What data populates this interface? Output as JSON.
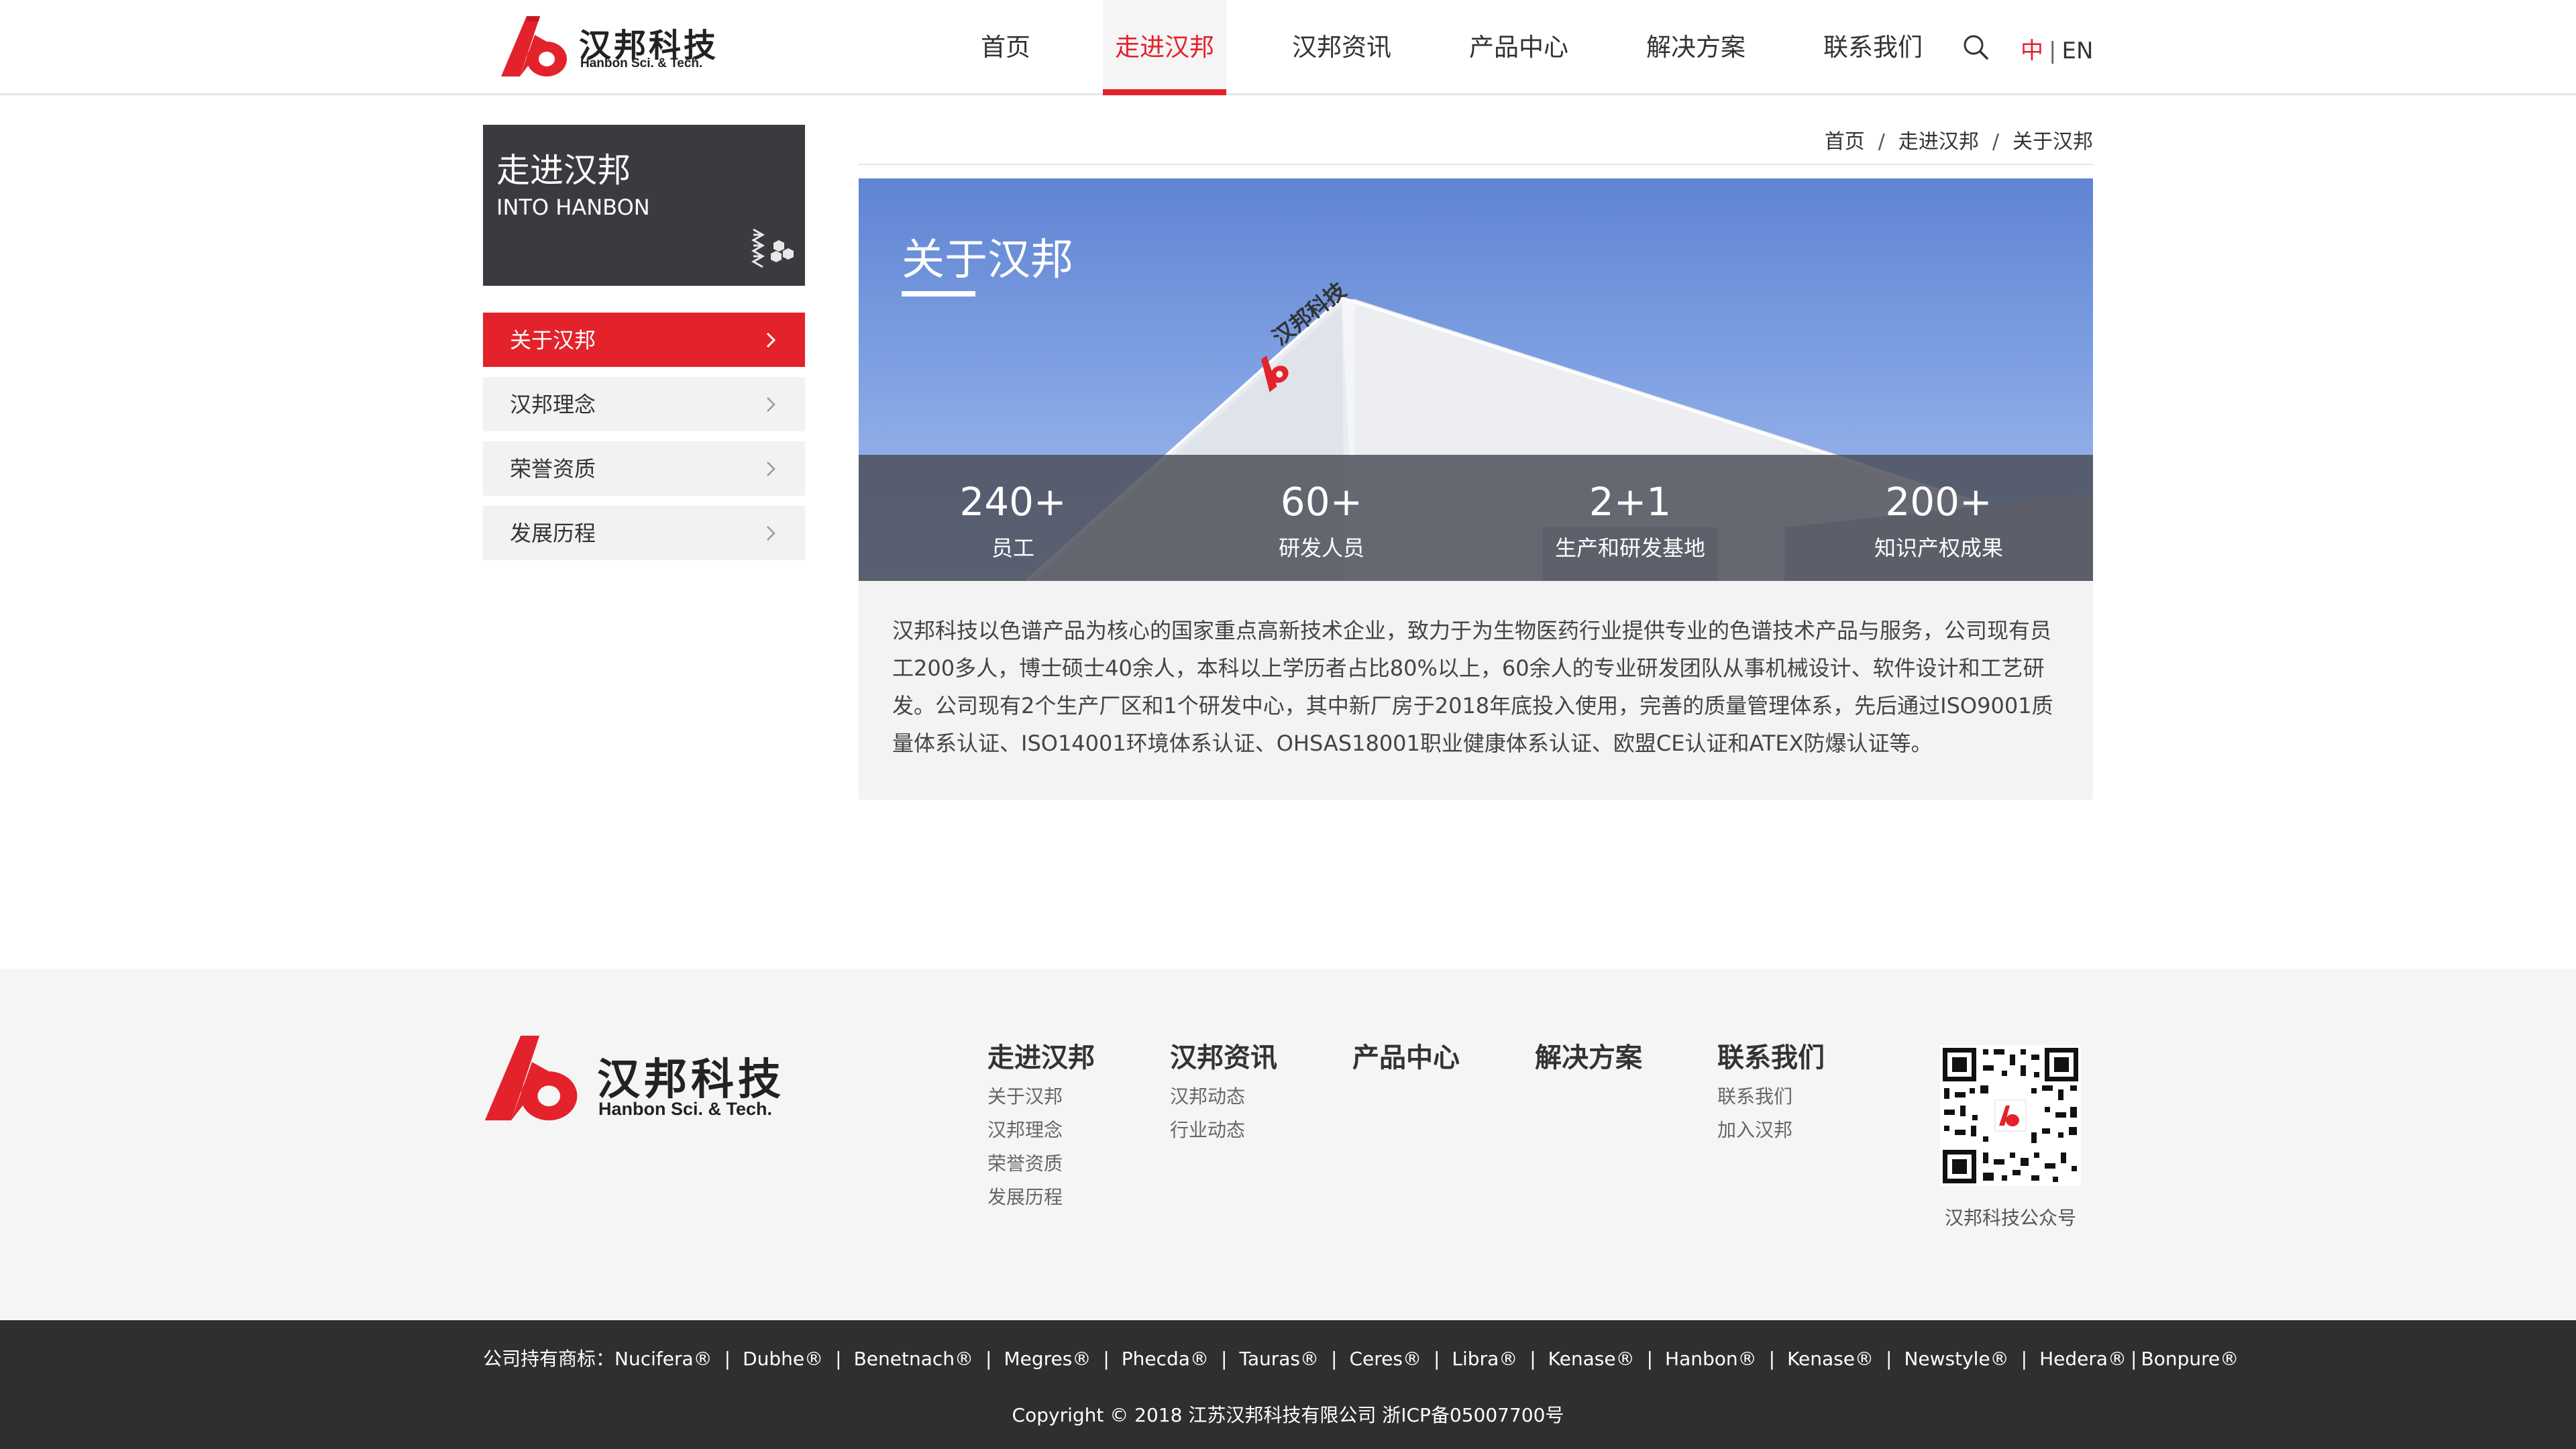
{
  "header": {
    "logo_cn": "汉邦科技",
    "logo_en": "Hanbon Sci. & Tech.",
    "nav": [
      {
        "label": "首页"
      },
      {
        "label": "走进汉邦"
      },
      {
        "label": "汉邦资讯"
      },
      {
        "label": "产品中心"
      },
      {
        "label": "解决方案"
      },
      {
        "label": "联系我们"
      }
    ],
    "active_nav": 1,
    "lang_zh": "中",
    "lang_sep": "|",
    "lang_en": "EN"
  },
  "sidebar": {
    "title": "走进汉邦",
    "subtitle": "INTO HANBON",
    "items": [
      {
        "label": "关于汉邦"
      },
      {
        "label": "汉邦理念"
      },
      {
        "label": "荣誉资质"
      },
      {
        "label": "发展历程"
      }
    ],
    "active_item": 0
  },
  "breadcrumb": [
    "首页",
    "走进汉邦",
    "关于汉邦"
  ],
  "hero": {
    "title": "关于汉邦",
    "building_sign": "汉邦科技",
    "stats": [
      {
        "number": "240+",
        "label": "员工"
      },
      {
        "number": "60+",
        "label": "研发人员"
      },
      {
        "number": "2+1",
        "label": "生产和研发基地"
      },
      {
        "number": "200+",
        "label": "知识产权成果"
      }
    ]
  },
  "intro": "汉邦科技以色谱产品为核心的国家重点高新技术企业，致力于为生物医药行业提供专业的色谱技术产品与服务，公司现有员工200多人，博士硕士40余人，本科以上学历者占比80%以上，60余人的专业研发团队从事机械设计、软件设计和工艺研发。公司现有2个生产厂区和1个研发中心，其中新厂房于2018年底投入使用，完善的质量管理体系，先后通过ISO9001质量体系认证、ISO14001环境体系认证、OHSAS18001职业健康体系认证、欧盟CE认证和ATEX防爆认证等。",
  "footer": {
    "logo_cn": "汉邦科技",
    "logo_en": "Hanbon Sci. & Tech.",
    "columns": [
      {
        "title": "走进汉邦",
        "links": [
          "关于汉邦",
          "汉邦理念",
          "荣誉资质",
          "发展历程"
        ]
      },
      {
        "title": "汉邦资讯",
        "links": [
          "汉邦动态",
          "行业动态"
        ]
      },
      {
        "title": "产品中心",
        "links": []
      },
      {
        "title": "解决方案",
        "links": []
      },
      {
        "title": "联系我们",
        "links": [
          "联系我们",
          "加入汉邦"
        ]
      }
    ],
    "qr_caption": "汉邦科技公众号",
    "trademark_prefix": "公司持有商标：",
    "trademarks": [
      "Nucifera®",
      "Dubhe®",
      "Benetnach®",
      "Megres®",
      "Phecda®",
      "Tauras®",
      "Ceres®",
      "Libra®",
      "Kenase®",
      "Hanbon®",
      "Kenase®",
      "Newstyle®",
      "Hedera®",
      "Bonpure®"
    ],
    "copyright": "Copyright © 2018 江苏汉邦科技有限公司 浙ICP备05007700号"
  },
  "colors": {
    "brand_red": "#e3222b",
    "dark_panel": "#3b3b3f",
    "footer_bottom": "#2f2f2f"
  },
  "icons": [
    "logo-icon",
    "search-icon",
    "molecule-icon",
    "chevron-right-icon",
    "qr-code"
  ]
}
